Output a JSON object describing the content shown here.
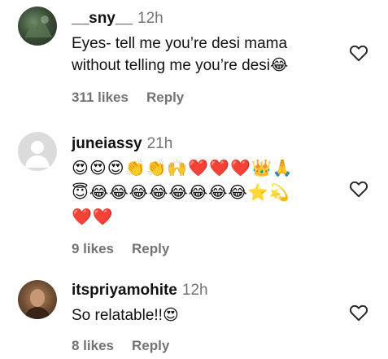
{
  "comments": [
    {
      "username": "__sny__",
      "time": "12h",
      "text": "Eyes- tell me you’re desi mama without telling me you’re desi😂",
      "likes": "311 likes",
      "reply": "Reply"
    },
    {
      "username": "juneiassy",
      "time": "21h",
      "emoji_line1": "😍😍😍👏👏🙌❤️❤️❤️👑🙏",
      "emoji_line2": "😇😂😂😂😂😂😂😂😂⭐💫",
      "emoji_line3": "❤️❤️",
      "likes": "9 likes",
      "reply": "Reply"
    },
    {
      "username": "itspriyamohite",
      "time": "12h",
      "text": "So relatable!!😍",
      "likes": "8 likes",
      "reply": "Reply"
    }
  ],
  "icons": {
    "like": "heart-outline-icon",
    "default_avatar": "default-avatar-icon"
  },
  "colors": {
    "muted": "#737373",
    "text": "#111111"
  }
}
